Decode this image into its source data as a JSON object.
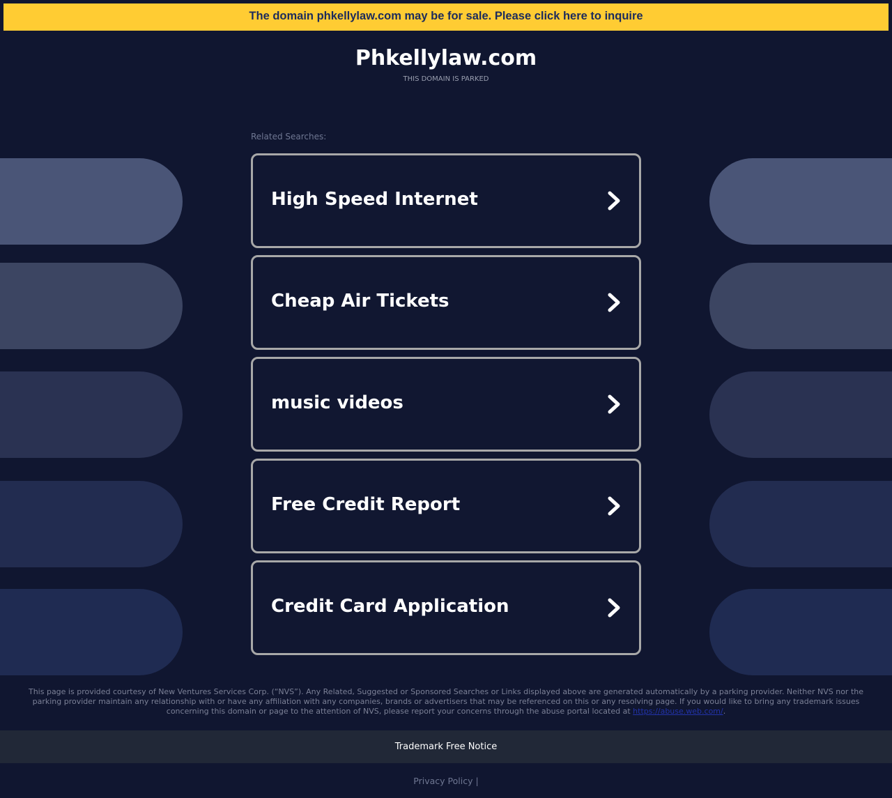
{
  "banner": {
    "text": "The domain phkellylaw.com may be for sale. Please click here to inquire"
  },
  "header": {
    "title": "Phkellylaw.com",
    "subtitle": "THIS DOMAIN IS PARKED"
  },
  "related": {
    "label": "Related Searches:",
    "items": [
      {
        "label": "High Speed Internet"
      },
      {
        "label": "Cheap Air Tickets"
      },
      {
        "label": "music videos"
      },
      {
        "label": "Free Credit Report"
      },
      {
        "label": "Credit Card Application"
      }
    ]
  },
  "footer": {
    "disclaimer_text": "This page is provided courtesy of New Ventures Services Corp. (“NVS”). Any Related, Suggested or Sponsored Searches or Links displayed above are generated automatically by a parking provider. Neither NVS nor the parking provider maintain any relationship with or have any affiliation with any companies, brands or advertisers that may be referenced on this or any resolving page. If you would like to bring any trademark issues concerning this domain or page to the attention of NVS, please report your concerns through the abuse portal located at",
    "abuse_link": "https://abuse.web.com/",
    "disclaimer_end": ".",
    "trademark_notice": "Trademark Free Notice",
    "privacy_policy": "Privacy Policy",
    "separator": "|"
  },
  "colors": {
    "background": "#101630",
    "banner_bg": "#ffcc33",
    "banner_text": "#1c2b5c",
    "card_border": "#a8a8a8",
    "pill_shades": [
      "#4a5577",
      "#3c4562",
      "#2a3252",
      "#222c50",
      "#1f2b52"
    ]
  },
  "icons": {
    "card_chevron": "chevron-right-icon"
  }
}
